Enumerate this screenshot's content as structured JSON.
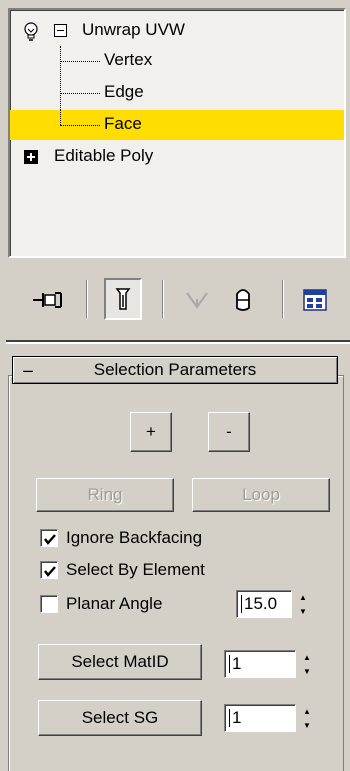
{
  "stack": {
    "items": [
      {
        "label": "Unwrap UVW"
      },
      {
        "label": "Vertex"
      },
      {
        "label": "Edge"
      },
      {
        "label": "Face"
      },
      {
        "label": "Editable Poly"
      }
    ],
    "selected_color": "#ffdd00"
  },
  "toolbar": {
    "icons": [
      "pin-stack-icon",
      "show-end-result-icon",
      "make-unique-icon",
      "remove-modifier-icon",
      "configure-modifier-sets-icon"
    ]
  },
  "rollout": {
    "title": "Selection Parameters",
    "collapse_label": "–",
    "grow_label": "+",
    "shrink_label": "-",
    "ring_label": "Ring",
    "loop_label": "Loop",
    "ignore_backfacing_label": "Ignore Backfacing",
    "ignore_backfacing_checked": true,
    "select_by_element_label": "Select By Element",
    "select_by_element_checked": true,
    "planar_angle_label": "Planar Angle",
    "planar_angle_checked": false,
    "planar_angle_value": "15.0",
    "select_matid_label": "Select MatID",
    "matid_value": "1",
    "select_sg_label": "Select SG",
    "sg_value": "1"
  }
}
